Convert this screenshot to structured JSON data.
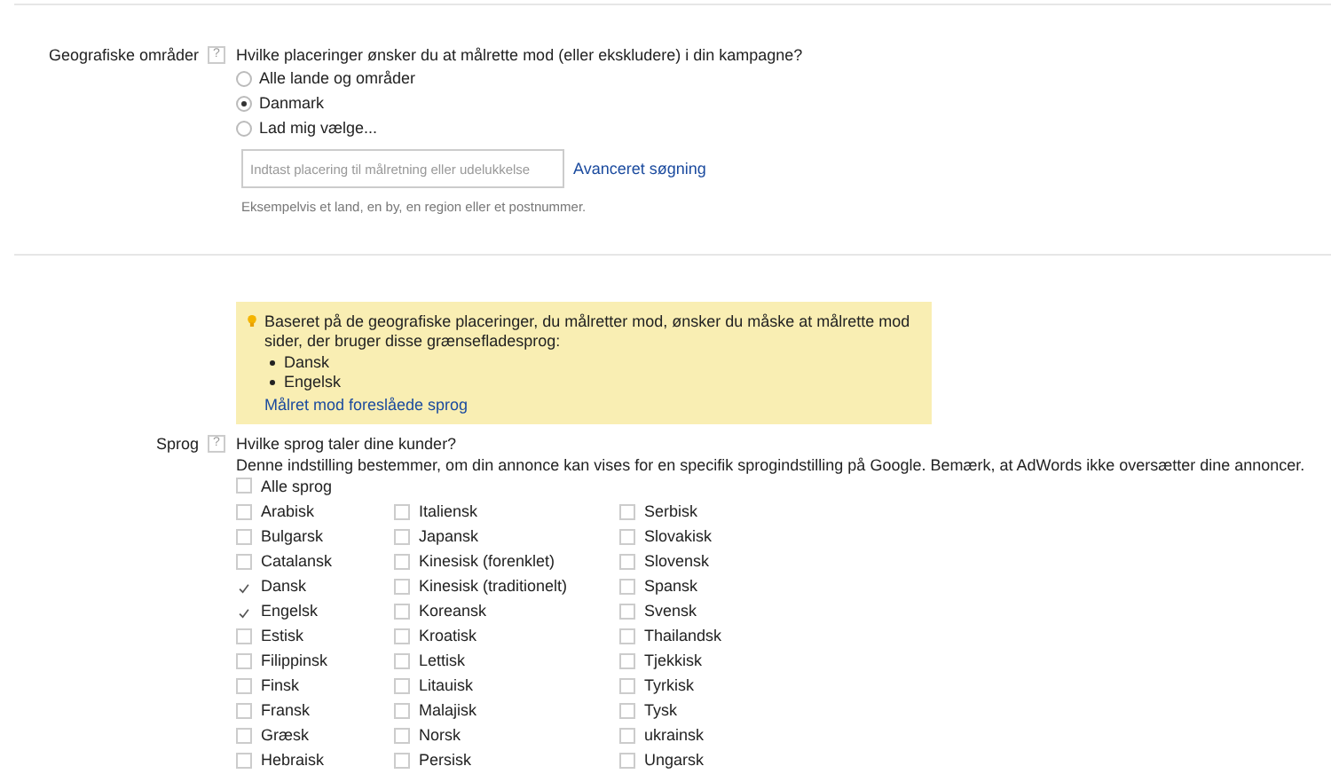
{
  "locations": {
    "label": "Geografiske områder",
    "help": "?",
    "question": "Hvilke placeringer ønsker du at målrette mod (eller ekskludere) i din kampagne?",
    "options": [
      {
        "label": "Alle lande og områder",
        "selected": false
      },
      {
        "label": "Danmark",
        "selected": true
      },
      {
        "label": "Lad mig vælge...",
        "selected": false
      }
    ],
    "search": {
      "placeholder": "Indtast placering til målretning eller udelukkelse"
    },
    "advanced_link": "Avanceret søgning",
    "hint": "Eksempelvis et land, en by, en region eller et postnummer."
  },
  "suggestion": {
    "text": "Baseret på de geografiske placeringer, du målretter mod, ønsker du måske at målrette mod sider, der bruger disse grænsefladesprog:",
    "items": [
      "Dansk",
      "Engelsk"
    ],
    "link": "Målret mod foreslåede sprog"
  },
  "languages": {
    "label": "Sprog",
    "help": "?",
    "question": "Hvilke sprog taler dine kunder?",
    "description": "Denne indstilling bestemmer, om din annonce kan vises for en specifik sprogindstilling på Google. Bemærk, at AdWords ikke oversætter dine annoncer.",
    "all": {
      "label": "Alle sprog",
      "checked": false
    },
    "columns": [
      [
        {
          "label": "Arabisk",
          "checked": false
        },
        {
          "label": "Bulgarsk",
          "checked": false
        },
        {
          "label": "Catalansk",
          "checked": false
        },
        {
          "label": "Dansk",
          "checked": true
        },
        {
          "label": "Engelsk",
          "checked": true
        },
        {
          "label": "Estisk",
          "checked": false
        },
        {
          "label": "Filippinsk",
          "checked": false
        },
        {
          "label": "Finsk",
          "checked": false
        },
        {
          "label": "Fransk",
          "checked": false
        },
        {
          "label": "Græsk",
          "checked": false
        },
        {
          "label": "Hebraisk",
          "checked": false
        }
      ],
      [
        {
          "label": "Italiensk",
          "checked": false
        },
        {
          "label": "Japansk",
          "checked": false
        },
        {
          "label": "Kinesisk (forenklet)",
          "checked": false
        },
        {
          "label": "Kinesisk (traditionelt)",
          "checked": false
        },
        {
          "label": "Koreansk",
          "checked": false
        },
        {
          "label": "Kroatisk",
          "checked": false
        },
        {
          "label": "Lettisk",
          "checked": false
        },
        {
          "label": "Litauisk",
          "checked": false
        },
        {
          "label": "Malajisk",
          "checked": false
        },
        {
          "label": "Norsk",
          "checked": false
        },
        {
          "label": "Persisk",
          "checked": false
        }
      ],
      [
        {
          "label": "Serbisk",
          "checked": false
        },
        {
          "label": "Slovakisk",
          "checked": false
        },
        {
          "label": "Slovensk",
          "checked": false
        },
        {
          "label": "Spansk",
          "checked": false
        },
        {
          "label": "Svensk",
          "checked": false
        },
        {
          "label": "Thailandsk",
          "checked": false
        },
        {
          "label": "Tjekkisk",
          "checked": false
        },
        {
          "label": "Tyrkisk",
          "checked": false
        },
        {
          "label": "Tysk",
          "checked": false
        },
        {
          "label": "ukrainsk",
          "checked": false
        },
        {
          "label": "Ungarsk",
          "checked": false
        }
      ]
    ]
  }
}
